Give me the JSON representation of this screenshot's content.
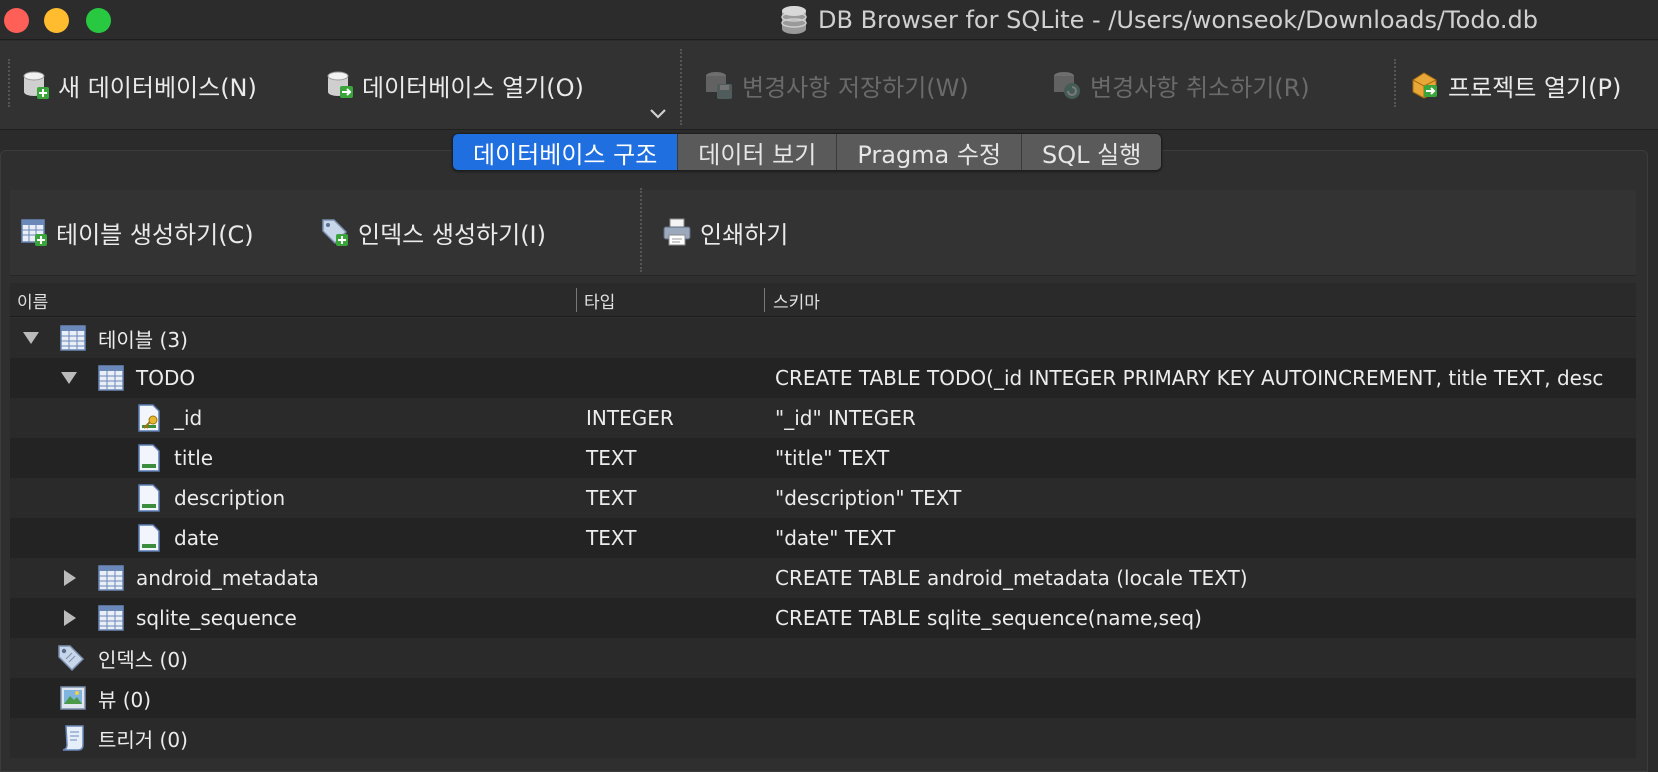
{
  "window": {
    "title": "DB Browser for SQLite - /Users/wonseok/Downloads/Todo.db"
  },
  "toolbar": {
    "new_db": "새 데이터베이스(N)",
    "open_db": "데이터베이스 열기(O)",
    "write_changes": "변경사항 저장하기(W)",
    "revert_changes": "변경사항 취소하기(R)",
    "open_project": "프로젝트 열기(P)"
  },
  "tabs": [
    {
      "label": "데이터베이스 구조",
      "active": true
    },
    {
      "label": "데이터 보기",
      "active": false
    },
    {
      "label": "Pragma 수정",
      "active": false
    },
    {
      "label": "SQL 실행",
      "active": false
    }
  ],
  "subtoolbar": {
    "create_table": "테이블 생성하기(C)",
    "create_index": "인덱스 생성하기(I)",
    "print": "인쇄하기"
  },
  "tree": {
    "headers": {
      "name": "이름",
      "type": "타입",
      "schema": "스키마"
    },
    "rows": [
      {
        "name": "테이블 (3)",
        "type": "",
        "schema": "",
        "icon": "table-icon",
        "expanded": true
      },
      {
        "name": "TODO",
        "type": "",
        "schema": "CREATE TABLE TODO(_id INTEGER PRIMARY KEY AUTOINCREMENT, title TEXT, desc",
        "icon": "table-icon",
        "expanded": true
      },
      {
        "name": "_id",
        "type": "INTEGER",
        "schema": "\"_id\" INTEGER",
        "icon": "primary-key-field-icon"
      },
      {
        "name": "title",
        "type": "TEXT",
        "schema": "\"title\" TEXT",
        "icon": "field-icon"
      },
      {
        "name": "description",
        "type": "TEXT",
        "schema": "\"description\" TEXT",
        "icon": "field-icon"
      },
      {
        "name": "date",
        "type": "TEXT",
        "schema": "\"date\" TEXT",
        "icon": "field-icon"
      },
      {
        "name": "android_metadata",
        "type": "",
        "schema": "CREATE TABLE android_metadata (locale TEXT)",
        "icon": "table-icon",
        "expanded": false
      },
      {
        "name": "sqlite_sequence",
        "type": "",
        "schema": "CREATE TABLE sqlite_sequence(name,seq)",
        "icon": "table-icon",
        "expanded": false
      },
      {
        "name": "인덱스 (0)",
        "type": "",
        "schema": "",
        "icon": "index-tag-icon"
      },
      {
        "name": "뷰 (0)",
        "type": "",
        "schema": "",
        "icon": "view-icon"
      },
      {
        "name": "트리거 (0)",
        "type": "",
        "schema": "",
        "icon": "trigger-scroll-icon"
      }
    ]
  },
  "colors": {
    "accent": "#1f6fe0",
    "background": "#2b2b2b"
  }
}
